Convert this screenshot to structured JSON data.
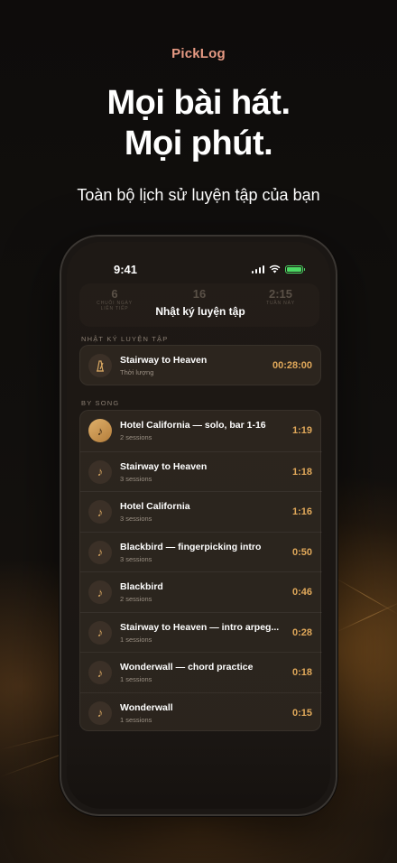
{
  "brand": "PickLog",
  "headline": {
    "line1": "Mọi bài hát.",
    "line2": "Mọi phút."
  },
  "subhead": "Toàn bộ lịch sử luyện tập của bạn",
  "status_bar": {
    "time": "9:41"
  },
  "ghost_stats": [
    {
      "value": "6",
      "label1": "CHUỖI NGÀY",
      "label2": "LIÊN TIẾP"
    },
    {
      "value": "16",
      "label1": "",
      "label2": ""
    },
    {
      "value": "2:15",
      "label1": "TUẦN NÀY",
      "label2": ""
    }
  ],
  "nav_title": "Nhật ký luyện tập",
  "practice_log": {
    "label": "NHẬT KÝ LUYỆN TẬP",
    "item": {
      "title": "Stairway to Heaven",
      "subtitle": "Thời lượng",
      "time": "00:28:00",
      "icon": "metronome-icon"
    }
  },
  "by_song": {
    "label": "BY SONG",
    "items": [
      {
        "title": "Hotel California — solo, bar 1-16",
        "sessions": "2 sessions",
        "time": "1:19",
        "active": true
      },
      {
        "title": "Stairway to Heaven",
        "sessions": "3 sessions",
        "time": "1:18"
      },
      {
        "title": "Hotel California",
        "sessions": "3 sessions",
        "time": "1:16"
      },
      {
        "title": "Blackbird — fingerpicking intro",
        "sessions": "3 sessions",
        "time": "0:50"
      },
      {
        "title": "Blackbird",
        "sessions": "2 sessions",
        "time": "0:46"
      },
      {
        "title": "Stairway to Heaven — intro arpeg...",
        "sessions": "1 sessions",
        "time": "0:28"
      },
      {
        "title": "Wonderwall — chord practice",
        "sessions": "1 sessions",
        "time": "0:18"
      },
      {
        "title": "Wonderwall",
        "sessions": "1 sessions",
        "time": "0:15"
      }
    ]
  },
  "colors": {
    "accent": "#e0a85a",
    "brand": "#e79a84",
    "battery": "#4cd964"
  }
}
